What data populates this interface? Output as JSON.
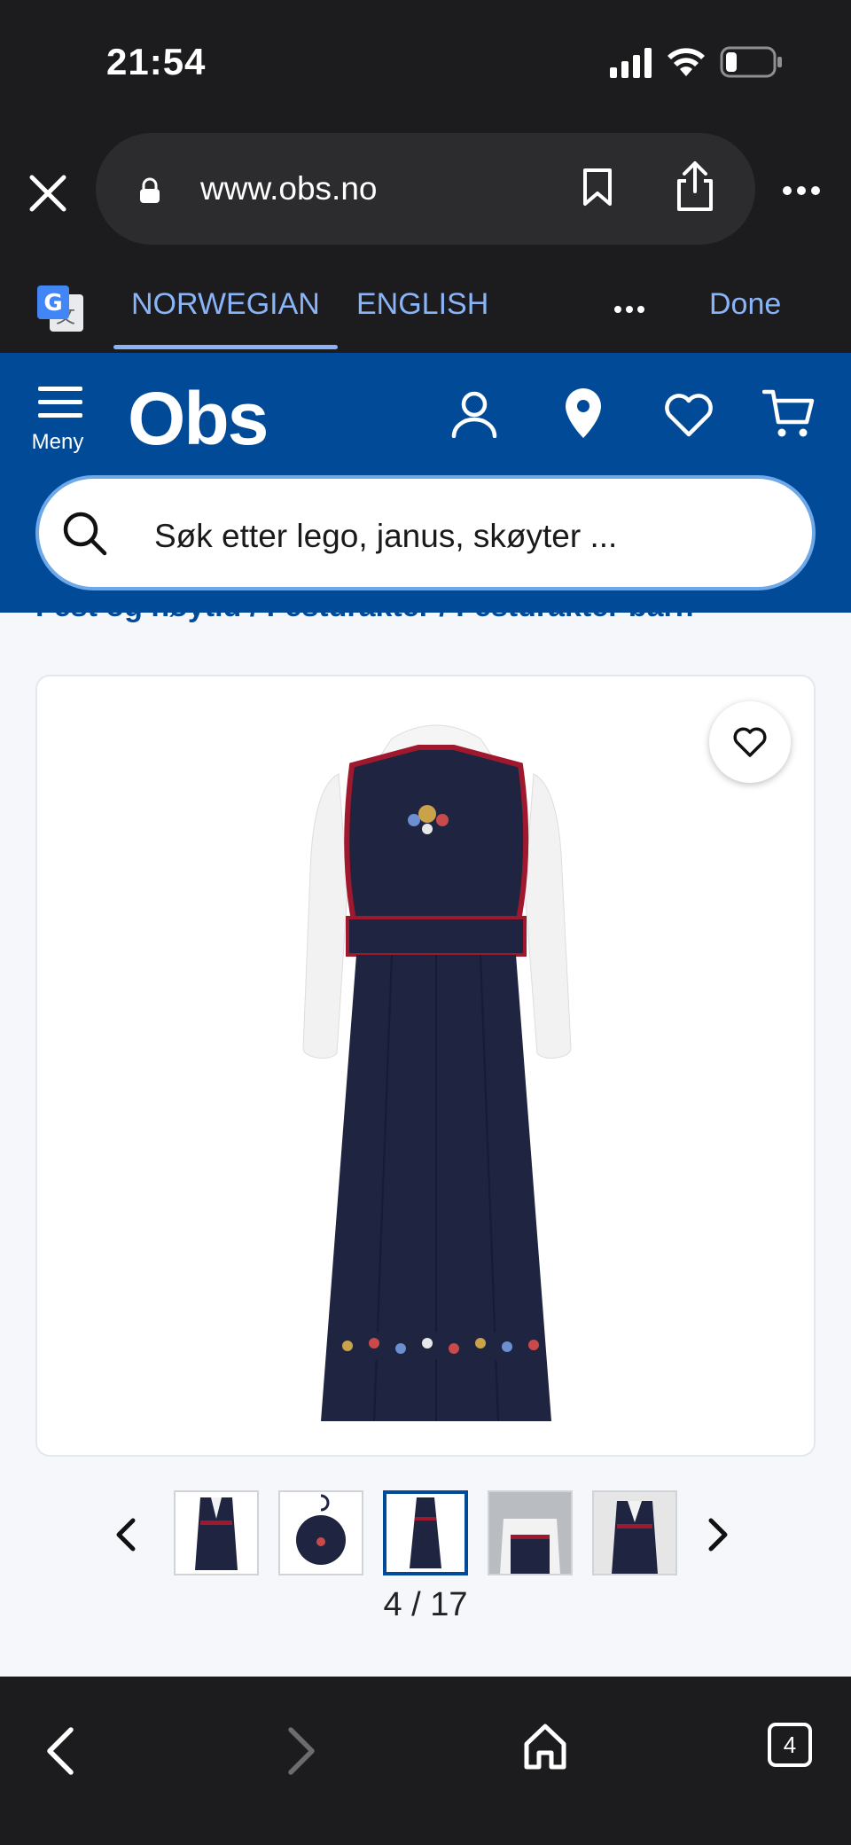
{
  "status_bar": {
    "time": "21:54"
  },
  "browser": {
    "url": "www.obs.no"
  },
  "translate_bar": {
    "tabs": [
      "NORWEGIAN",
      "ENGLISH"
    ],
    "done_label": "Done"
  },
  "site_header": {
    "logo": "Obs",
    "menu_label": "Meny",
    "search_placeholder": "Søk etter lego, janus, skøyter ..."
  },
  "breadcrumb": "Fest og høytid / Festdrakter / Festdrakter barn",
  "gallery": {
    "counter": "4 / 17",
    "thumbnail_count": 5,
    "active_thumbnail_index": 2
  },
  "bottom_bar": {
    "tab_count": "4"
  },
  "colors": {
    "brand_blue": "#004a98",
    "browser_dark": "#1c1c1e",
    "translate_accent": "#8ab4f8",
    "dress_navy": "#1f2440",
    "trim_red": "#a0182e"
  },
  "icons": [
    "close-icon",
    "lock-icon",
    "bookmark-icon",
    "share-icon",
    "more-icon",
    "google-translate-icon",
    "hamburger-icon",
    "user-icon",
    "location-pin-icon",
    "heart-icon",
    "cart-icon",
    "search-icon",
    "chevron-left-icon",
    "chevron-right-icon",
    "home-icon"
  ]
}
